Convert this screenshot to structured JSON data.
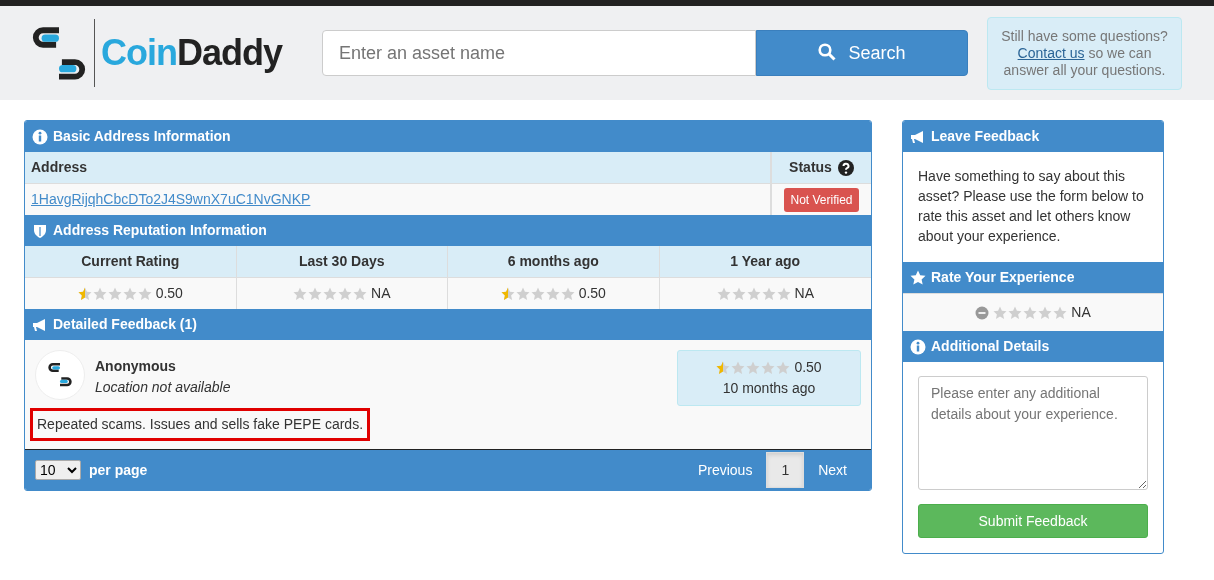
{
  "logo": {
    "part1": "Coin",
    "part2": "Daddy"
  },
  "search": {
    "placeholder": "Enter an asset name",
    "button": "Search"
  },
  "help": {
    "before": "Still have some questions?",
    "link": "Contact us",
    "after": "so we can answer all your questions."
  },
  "basic_info": {
    "title": "Basic Address Information",
    "columns": [
      "Address",
      "Status"
    ],
    "address": "1HavgRijqhCbcDTo2J4S9wnX7uC1NvGNKP",
    "status": "Not Verified"
  },
  "reputation": {
    "title": "Address Reputation Information",
    "periods": [
      {
        "label": "Current Rating",
        "stars": 0.5,
        "reading": "0.50"
      },
      {
        "label": "Last 30 Days",
        "stars": 0,
        "reading": "NA"
      },
      {
        "label": "6 months ago",
        "stars": 0.5,
        "reading": "0.50"
      },
      {
        "label": "1 Year ago",
        "stars": 0,
        "reading": "NA"
      }
    ]
  },
  "feedback": {
    "title": "Detailed Feedback (1)",
    "items": [
      {
        "author": "Anonymous",
        "location": "Location not available",
        "stars": 0.5,
        "reading": "0.50",
        "time": "10 months ago",
        "comment": "Repeated scams. Issues and sells fake PEPE cards.",
        "highlighted": true
      }
    ],
    "per_page": "10",
    "per_page_label": "per page",
    "pages": [
      {
        "label": "Previous",
        "kind": "nav",
        "selected": false
      },
      {
        "label": "1",
        "kind": "page",
        "selected": true
      },
      {
        "label": "Next",
        "kind": "nav",
        "selected": false
      }
    ]
  },
  "leave_feedback": {
    "title": "Leave Feedback",
    "text": "Have something to say about this asset? Please use the form below to rate this asset and let others know about your experience.",
    "rate_title": "Rate Your Experience",
    "rating": {
      "stars": 0,
      "reading": "NA"
    },
    "details_title": "Additional Details",
    "details_placeholder": "Please enter any additional details about your experience.",
    "submit": "Submit Feedback"
  }
}
